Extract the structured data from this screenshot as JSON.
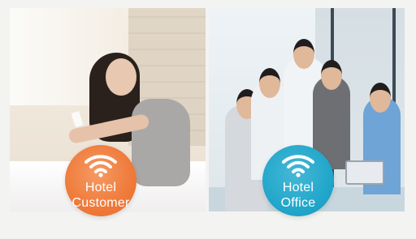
{
  "left_badge": {
    "line1": "Hotel",
    "line2": "Customer",
    "icon": "wifi-icon",
    "color": "#ef7a3a"
  },
  "right_badge": {
    "line1": "Hotel",
    "line2": "Office",
    "icon": "wifi-icon",
    "color": "#22a7cb"
  }
}
